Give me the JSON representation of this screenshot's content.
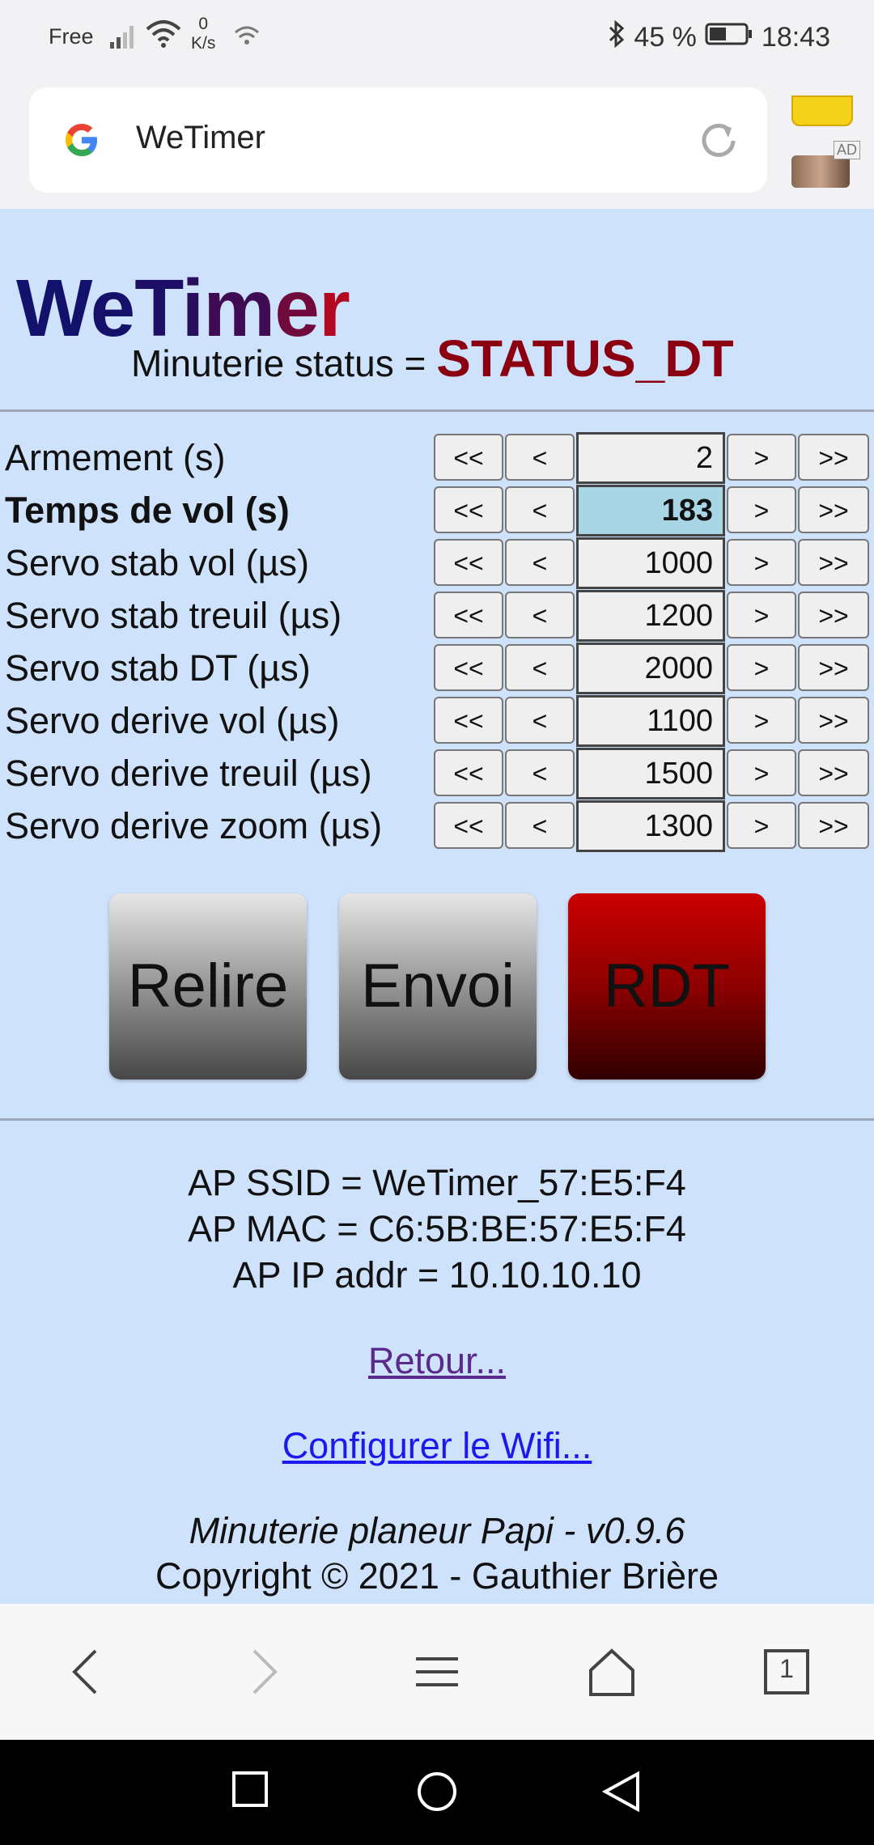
{
  "statusbar": {
    "carrier": "Free",
    "speed_top": "0",
    "speed_unit": "K/s",
    "battery": "45 %",
    "time": "18:43"
  },
  "browser": {
    "url": "WeTimer",
    "ad_label": "AD"
  },
  "page": {
    "title_letters": [
      {
        "ch": "W",
        "color": "#12116b"
      },
      {
        "ch": "e",
        "color": "#15106a"
      },
      {
        "ch": "T",
        "color": "#1d0f65"
      },
      {
        "ch": "i",
        "color": "#2a0e5e"
      },
      {
        "ch": "m",
        "color": "#3f0c54"
      },
      {
        "ch": "e",
        "color": "#700a3c"
      },
      {
        "ch": "r",
        "color": "#b20820"
      }
    ],
    "status_label": "Minuterie status = ",
    "status_value": "STATUS_DT",
    "params": [
      {
        "label": "Armement (s)",
        "value": "2",
        "bold": false
      },
      {
        "label": "Temps de vol (s)",
        "value": "183",
        "bold": true
      },
      {
        "label": "Servo stab vol (µs)",
        "value": "1000",
        "bold": false
      },
      {
        "label": "Servo stab treuil (µs)",
        "value": "1200",
        "bold": false
      },
      {
        "label": "Servo stab DT (µs)",
        "value": "2000",
        "bold": false
      },
      {
        "label": "Servo derive vol (µs)",
        "value": "1100",
        "bold": false
      },
      {
        "label": "Servo derive treuil (µs)",
        "value": "1500",
        "bold": false
      },
      {
        "label": "Servo derive zoom (µs)",
        "value": "1300",
        "bold": false
      }
    ],
    "stepper_labels": {
      "fast_down": "<<",
      "down": "<",
      "up": ">",
      "fast_up": ">>"
    },
    "buttons": {
      "reload": "Relire",
      "send": "Envoi",
      "rdt": "RDT"
    },
    "ap_ssid": "AP SSID = WeTimer_57:E5:F4",
    "ap_mac": "AP MAC = C6:5B:BE:57:E5:F4",
    "ap_ip": "AP IP addr = 10.10.10.10",
    "link_back": "Retour...",
    "link_wifi": "Configurer le Wifi...",
    "footer_version": "Minuterie planeur Papi - v0.9.6",
    "footer_copyright": "Copyright © 2021 - Gauthier Brière"
  },
  "browsernav": {
    "tabs_count": "1"
  }
}
